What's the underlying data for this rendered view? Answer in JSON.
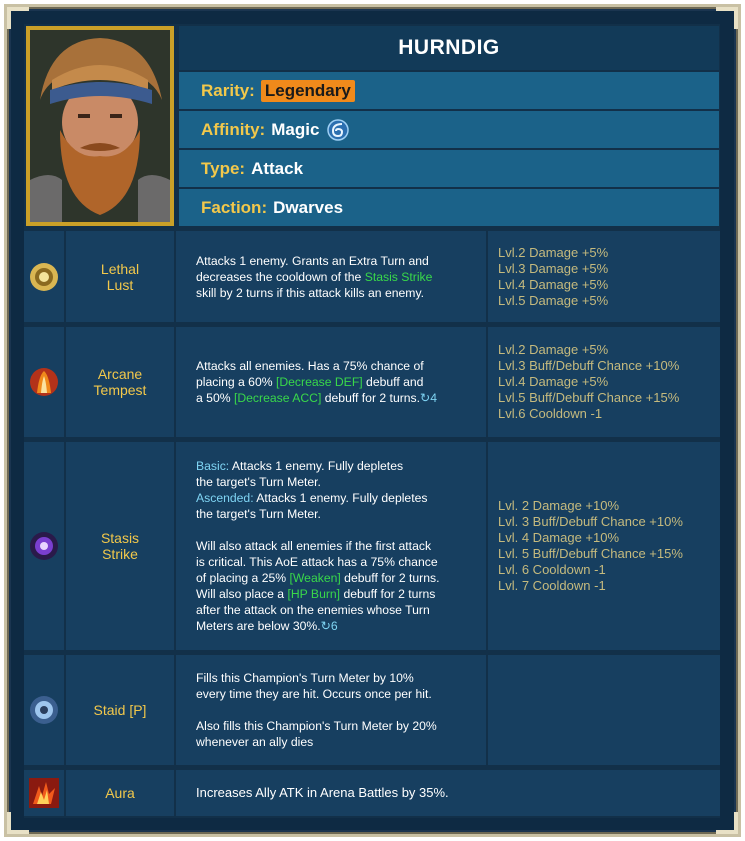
{
  "champion": {
    "name": "HURNDIG",
    "rarity_label": "Rarity:",
    "rarity": "Legendary",
    "affinity_label": "Affinity:",
    "affinity": "Magic",
    "affinity_icon": "magic-affinity-icon",
    "type_label": "Type:",
    "type": "Attack",
    "faction_label": "Faction:",
    "faction": "Dwarves"
  },
  "colors": {
    "accent_gold": "#f2c84b",
    "rarity_orange": "#f08a1b",
    "highlight_green": "#39d84a",
    "ability_cyan": "#7fd4f3",
    "book_text": "#c5ba7e"
  },
  "skills": [
    {
      "name_line1": "Lethal",
      "name_line2": "Lust",
      "icon": "lethal-lust-icon",
      "desc": [
        {
          "pre": "Attacks 1 enemy. Grants an Extra Turn and",
          "hl": "",
          "post": ""
        },
        {
          "pre": "decreases the cooldown of the ",
          "hl": "Stasis Strike",
          "post": ""
        },
        {
          "pre": "skill by 2 turns if this attack kills an enemy.",
          "hl": "",
          "post": ""
        }
      ],
      "books": [
        "Lvl.2 Damage +5%",
        "Lvl.3 Damage +5%",
        "Lvl.4 Damage +5%",
        "Lvl.5 Damage +5%"
      ]
    },
    {
      "name_line1": "Arcane",
      "name_line2": "Tempest",
      "icon": "arcane-tempest-icon",
      "desc": [
        {
          "pre": "Attacks all enemies. Has a 75% chance of",
          "hl": "",
          "post": ""
        },
        {
          "pre": "placing a 60% ",
          "hl": "[Decrease DEF]",
          "post": " debuff and"
        },
        {
          "pre": "a 50% ",
          "hl": "[Decrease ACC]",
          "post": " debuff for 2 turns."
        }
      ],
      "cooldown": "4",
      "books": [
        "Lvl.2 Damage +5%",
        "Lvl.3 Buff/Debuff Chance +10%",
        "Lvl.4 Damage +5%",
        "Lvl.5 Buff/Debuff Chance +15%",
        "Lvl.6 Cooldown -1"
      ]
    },
    {
      "name_line1": "Stasis",
      "name_line2": "Strike",
      "icon": "stasis-strike-icon",
      "basic_label": "Basic:",
      "basic_line1": " Attacks 1 enemy. Fully depletes",
      "basic_line2": "the target's Turn Meter.",
      "ascended_label": "Ascended:",
      "ascended_line1": " Attacks 1 enemy. Fully depletes",
      "ascended_line2": "the target's Turn Meter.",
      "desc": [
        {
          "pre": "Will also attack all enemies if the first attack",
          "hl": "",
          "post": ""
        },
        {
          "pre": "is critical. This AoE attack has a 75% chance",
          "hl": "",
          "post": ""
        },
        {
          "pre": "of placing a 25% ",
          "hl": "[Weaken]",
          "post": " debuff for 2 turns."
        },
        {
          "pre": "Will also place a ",
          "hl": "[HP Burn]",
          "post": " debuff for 2 turns"
        },
        {
          "pre": "after the attack on the enemies whose Turn",
          "hl": "",
          "post": ""
        },
        {
          "pre": "Meters are below 30%.",
          "hl": "",
          "post": ""
        }
      ],
      "cooldown": "6",
      "books": [
        "Lvl. 2 Damage +10%",
        "Lvl. 3 Buff/Debuff Chance +10%",
        "Lvl. 4 Damage +10%",
        "Lvl. 5 Buff/Debuff Chance +15%",
        "Lvl. 6 Cooldown -1",
        "Lvl. 7 Cooldown -1"
      ]
    },
    {
      "name_line1": "Staid [P]",
      "icon": "staid-passive-icon",
      "desc1": [
        "Fills this Champion's Turn Meter by 10%",
        "every time they are hit. Occurs once per hit."
      ],
      "desc2": [
        "Also fills this Champion's Turn Meter by 20%",
        "whenever an ally dies"
      ]
    }
  ],
  "aura": {
    "name": "Aura",
    "icon": "aura-icon",
    "desc": "Increases Ally ATK in Arena Battles by 35%."
  }
}
